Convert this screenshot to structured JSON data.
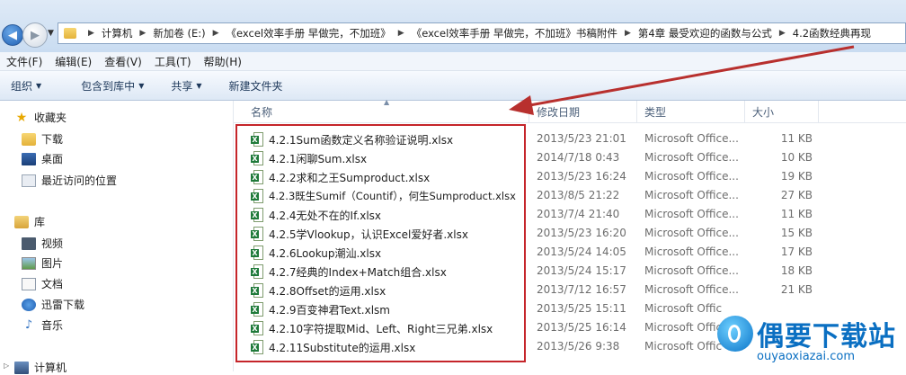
{
  "breadcrumbs": [
    "计算机",
    "新加卷 (E:)",
    "《excel效率手册 早做完，不加班》",
    "《excel效率手册 早做完，不加班》书稿附件",
    "第4章 最受欢迎的函数与公式",
    "4.2函数经典再现"
  ],
  "menu": [
    "文件(F)",
    "编辑(E)",
    "查看(V)",
    "工具(T)",
    "帮助(H)"
  ],
  "toolbar": {
    "organize": "组织",
    "include": "包含到库中",
    "share": "共享",
    "new_folder": "新建文件夹"
  },
  "nav": {
    "favorites": "收藏夹",
    "downloads": "下载",
    "desktop": "桌面",
    "recent": "最近访问的位置",
    "libraries": "库",
    "videos": "视频",
    "pictures": "图片",
    "documents": "文档",
    "xunlei": "迅雷下载",
    "music": "音乐",
    "computer": "计算机"
  },
  "columns": {
    "name": "名称",
    "date": "修改日期",
    "type": "类型",
    "size": "大小"
  },
  "files": [
    {
      "name": "4.2.1Sum函数定义名称验证说明.xlsx",
      "date": "2013/5/23 21:01",
      "type": "Microsoft Office...",
      "size": "11 KB"
    },
    {
      "name": "4.2.1闲聊Sum.xlsx",
      "date": "2014/7/18 0:43",
      "type": "Microsoft Office...",
      "size": "10 KB"
    },
    {
      "name": "4.2.2求和之王Sumproduct.xlsx",
      "date": "2013/5/23 16:24",
      "type": "Microsoft Office...",
      "size": "19 KB"
    },
    {
      "name": "4.2.3既生Sumif（Countif），何生Sumproduct.xlsx",
      "date": "2013/8/5 21:22",
      "type": "Microsoft Office...",
      "size": "27 KB"
    },
    {
      "name": "4.2.4无处不在的If.xlsx",
      "date": "2013/7/4 21:40",
      "type": "Microsoft Office...",
      "size": "11 KB"
    },
    {
      "name": "4.2.5学Vlookup，认识Excel爱好者.xlsx",
      "date": "2013/5/23 16:20",
      "type": "Microsoft Office...",
      "size": "15 KB"
    },
    {
      "name": "4.2.6Lookup潮汕.xlsx",
      "date": "2013/5/24 14:05",
      "type": "Microsoft Office...",
      "size": "17 KB"
    },
    {
      "name": "4.2.7经典的Index+Match组合.xlsx",
      "date": "2013/5/24 15:17",
      "type": "Microsoft Office...",
      "size": "18 KB"
    },
    {
      "name": "4.2.8Offset的运用.xlsx",
      "date": "2013/7/12 16:57",
      "type": "Microsoft Office...",
      "size": "21 KB"
    },
    {
      "name": "4.2.9百变神君Text.xlsm",
      "date": "2013/5/25 15:11",
      "type": "Microsoft Offic",
      "size": ""
    },
    {
      "name": "4.2.10字符提取Mid、Left、Right三兄弟.xlsx",
      "date": "2013/5/25 16:14",
      "type": "Microsoft Offic",
      "size": ""
    },
    {
      "name": "4.2.11Substitute的运用.xlsx",
      "date": "2013/5/26 9:38",
      "type": "Microsoft Offic",
      "size": ""
    }
  ],
  "watermark": {
    "title": "偶要下载站",
    "url": "ouyaoxiazai.com"
  },
  "colors": {
    "highlight": "#c5252a",
    "watermark": "#0a6fc2"
  }
}
